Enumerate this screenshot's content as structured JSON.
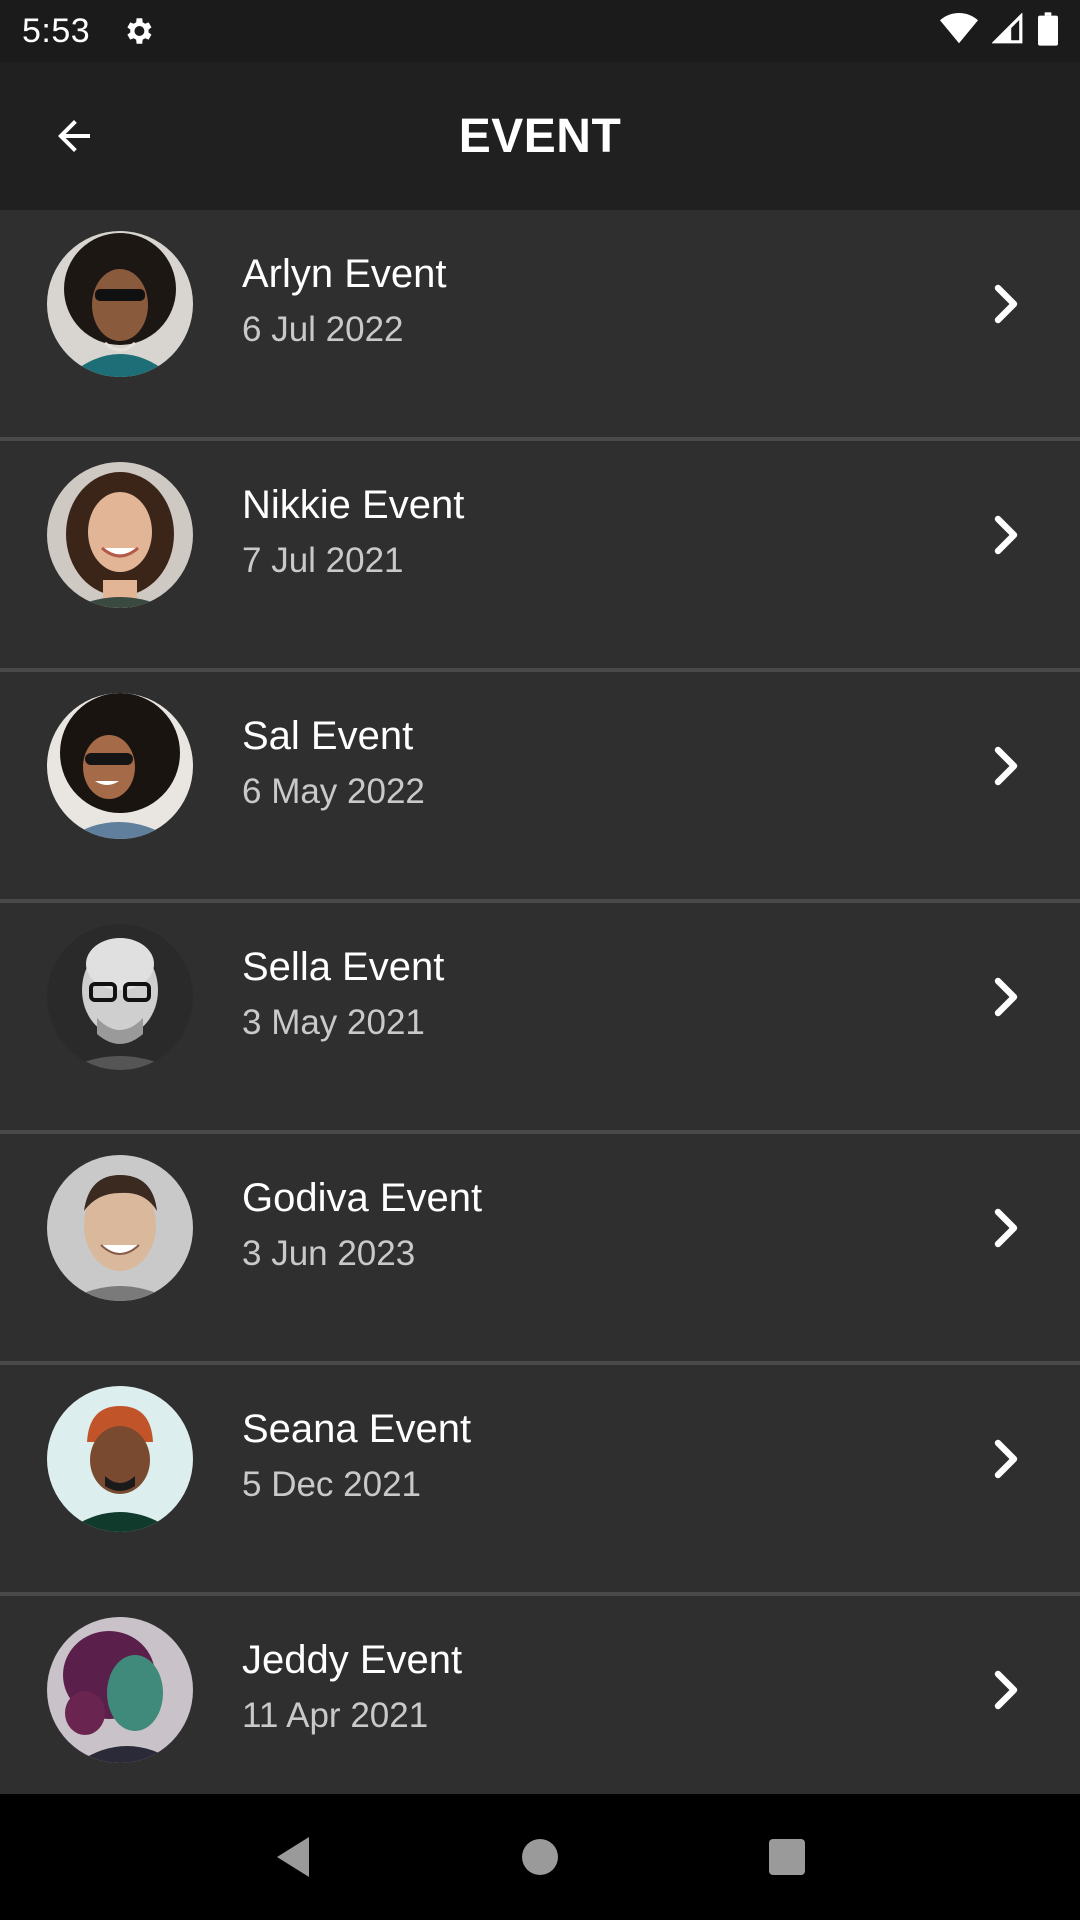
{
  "status_bar": {
    "time": "5:53",
    "icons": [
      "settings-gear-icon",
      "wifi-icon",
      "cell-signal-icon",
      "battery-icon"
    ]
  },
  "app_bar": {
    "title": "EVENT",
    "back_icon": "arrow-back-icon"
  },
  "events": [
    {
      "name": "Arlyn Event",
      "date": "6 Jul 2022"
    },
    {
      "name": "Nikkie Event",
      "date": "7 Jul 2021"
    },
    {
      "name": "Sal Event",
      "date": "6 May 2022"
    },
    {
      "name": "Sella Event",
      "date": "3 May 2021"
    },
    {
      "name": "Godiva Event",
      "date": "3 Jun 2023"
    },
    {
      "name": "Seana Event",
      "date": "5 Dec 2021"
    },
    {
      "name": "Jeddy Event",
      "date": "11 Apr 2021"
    }
  ],
  "nav_bar": {
    "icons": [
      "nav-back-triangle-icon",
      "nav-home-circle-icon",
      "nav-recents-square-icon"
    ]
  },
  "colors": {
    "status_bar_bg": "#1b1b1b",
    "app_bar_bg": "#202021",
    "list_item_bg": "#2f2f30",
    "divider": "#4a4a4b",
    "primary_text": "#ffffff",
    "secondary_text": "#c9c9c9",
    "nav_bar_bg": "#000000"
  }
}
